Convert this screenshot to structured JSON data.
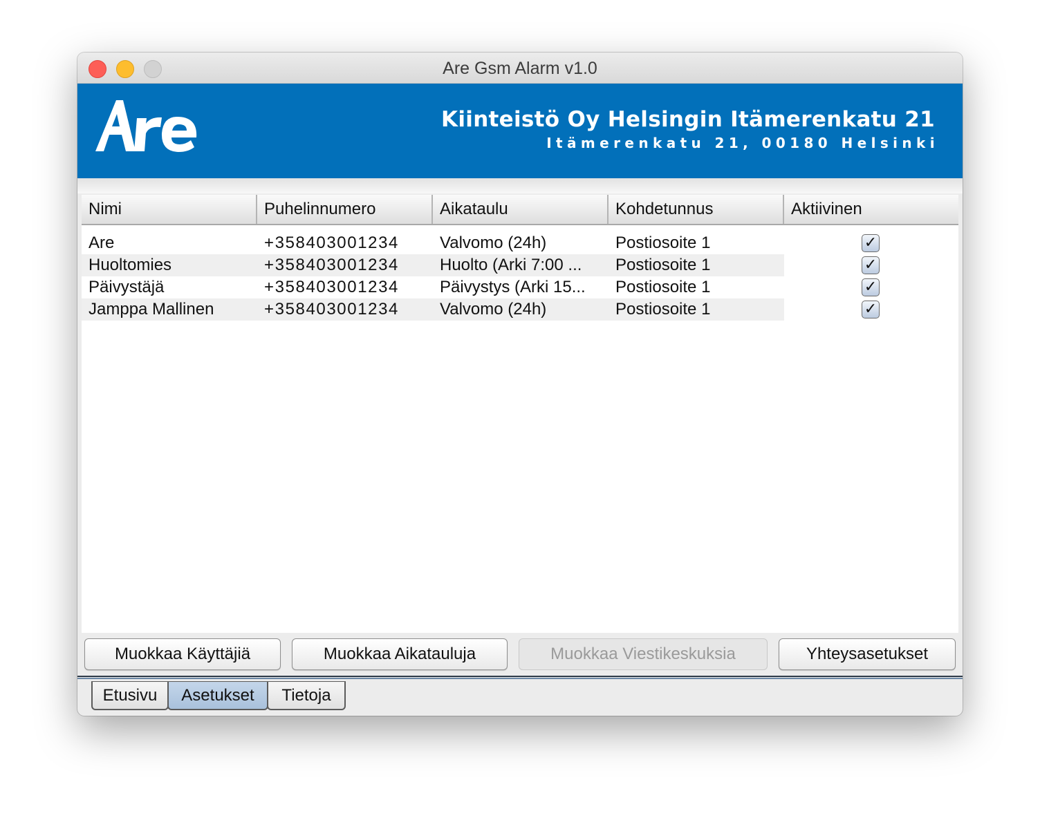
{
  "window": {
    "title": "Are Gsm Alarm v1.0"
  },
  "banner": {
    "logo_text": "Are",
    "company_name": "Kiinteistö Oy Helsingin Itämerenkatu 21",
    "company_address": "Itämerenkatu 21, 00180 Helsinki",
    "color": "#0270ba"
  },
  "table": {
    "columns": [
      "Nimi",
      "Puhelinnumero",
      "Aikataulu",
      "Kohdetunnus",
      "Aktiivinen"
    ],
    "rows": [
      {
        "name": "Are",
        "phone": "+358403001234",
        "schedule": "Valvomo (24h)",
        "target": "Postiosoite 1",
        "active": true
      },
      {
        "name": "Huoltomies",
        "phone": "+358403001234",
        "schedule": "Huolto (Arki 7:00 ...",
        "target": "Postiosoite 1",
        "active": true
      },
      {
        "name": "Päivystäjä",
        "phone": "+358403001234",
        "schedule": "Päivystys (Arki 15...",
        "target": "Postiosoite 1",
        "active": true
      },
      {
        "name": "Jamppa Mallinen",
        "phone": "+358403001234",
        "schedule": "Valvomo (24h)",
        "target": "Postiosoite 1",
        "active": true
      }
    ],
    "checkmark": "✓"
  },
  "buttons": {
    "edit_users": "Muokkaa Käyttäjiä",
    "edit_schedules": "Muokkaa Aikatauluja",
    "edit_message_centers": "Muokkaa Viestikeskuksia",
    "connection_settings": "Yhteysasetukset"
  },
  "tabs": {
    "items": [
      "Etusivu",
      "Asetukset",
      "Tietoja"
    ],
    "active": "Asetukset"
  }
}
